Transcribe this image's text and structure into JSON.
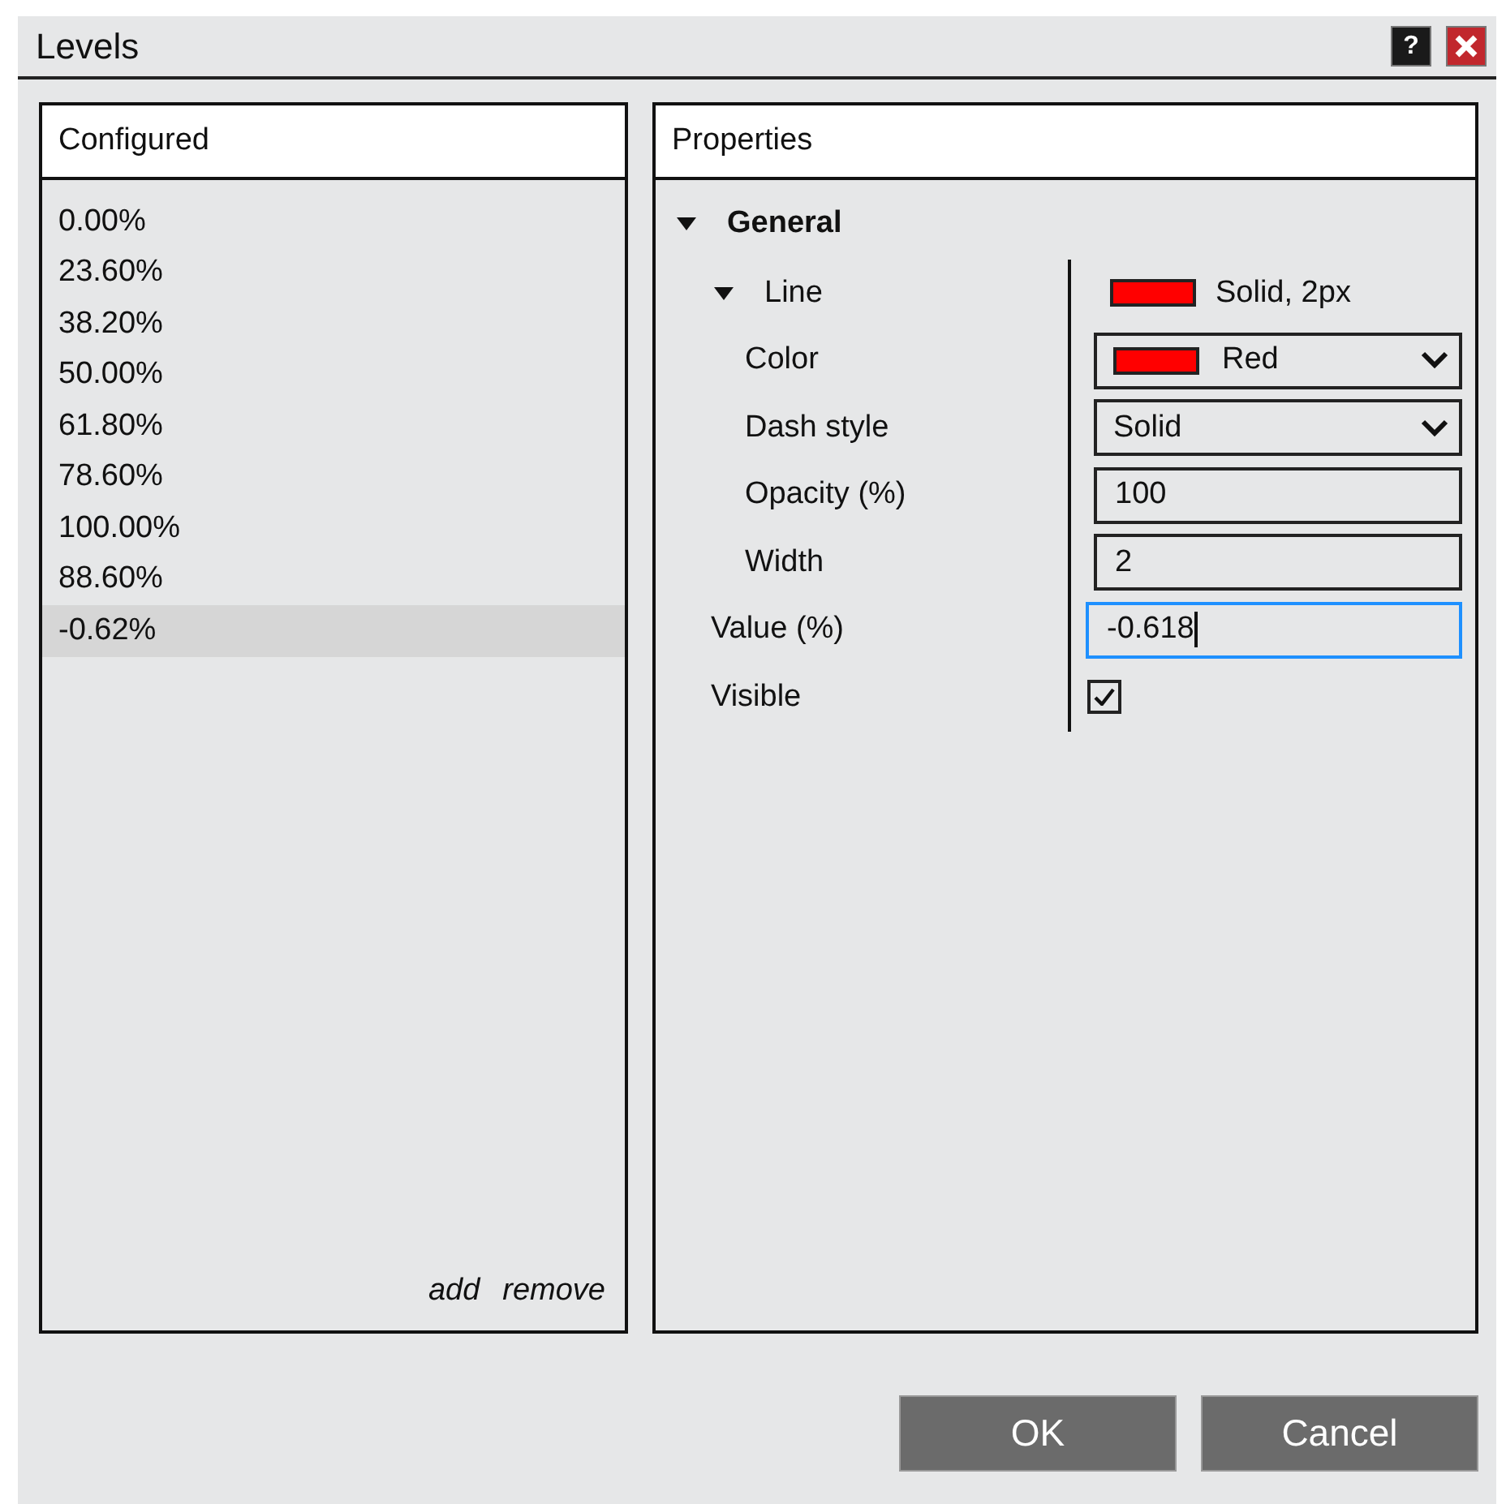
{
  "window": {
    "title": "Levels",
    "help_button": "?"
  },
  "configured": {
    "header": "Configured",
    "items": [
      {
        "label": "0.00%",
        "selected": false
      },
      {
        "label": "23.60%",
        "selected": false
      },
      {
        "label": "38.20%",
        "selected": false
      },
      {
        "label": "50.00%",
        "selected": false
      },
      {
        "label": "61.80%",
        "selected": false
      },
      {
        "label": "78.60%",
        "selected": false
      },
      {
        "label": "100.00%",
        "selected": false
      },
      {
        "label": "88.60%",
        "selected": false
      },
      {
        "label": "-0.62%",
        "selected": true
      }
    ],
    "links": [
      "add",
      "remove"
    ]
  },
  "properties": {
    "header": "Properties",
    "tree": [
      {
        "label": "General",
        "kind": "group",
        "expanded": true,
        "children": [
          {
            "label": "Line",
            "kind": "group",
            "expanded": true,
            "summary": {
              "color": "#ff0000",
              "text": "Solid, 2px"
            },
            "children": [
              {
                "label": "Color",
                "kind": "color-dropdown",
                "value": "Red",
                "color": "#ff0000"
              },
              {
                "label": "Dash style",
                "kind": "dropdown",
                "value": "Solid"
              },
              {
                "label": "Opacity (%)",
                "kind": "text",
                "value": "100",
                "focused": false
              },
              {
                "label": "Width",
                "kind": "text",
                "value": "2",
                "focused": false
              }
            ]
          },
          {
            "label": "Value (%)",
            "kind": "text",
            "value": "-0.618",
            "focused": true
          },
          {
            "label": "Visible",
            "kind": "checkbox",
            "checked": true
          }
        ]
      }
    ]
  },
  "buttons": [
    "OK",
    "Cancel"
  ]
}
